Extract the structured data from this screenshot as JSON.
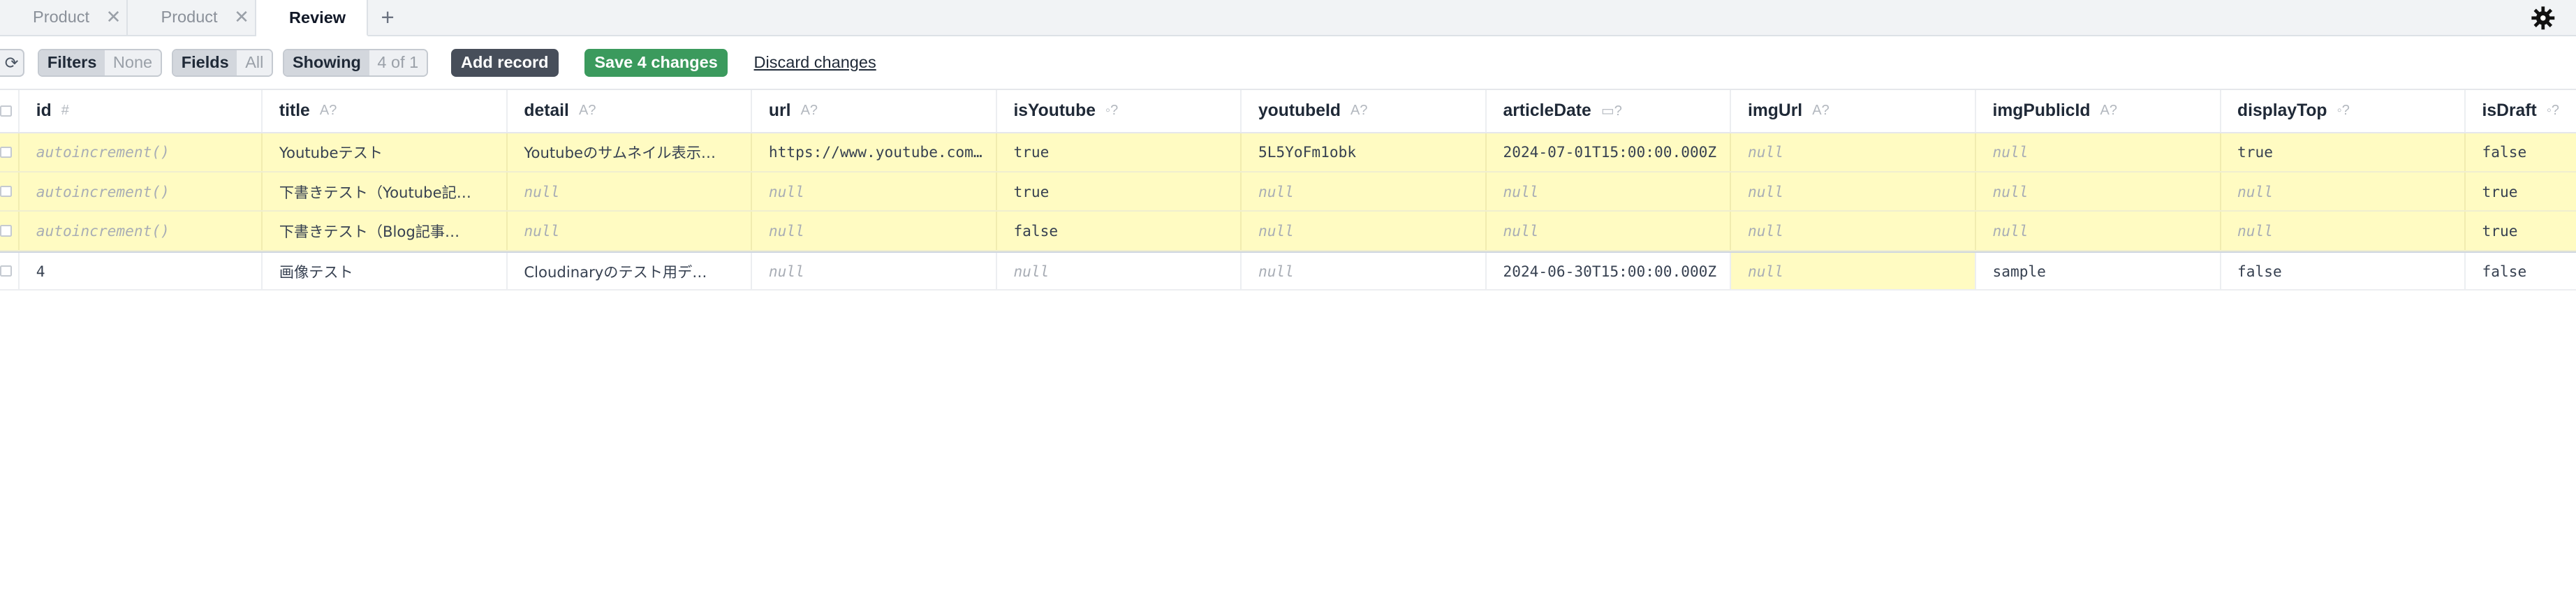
{
  "tabs": [
    {
      "label": "Product",
      "active": false,
      "closable": true
    },
    {
      "label": "Product",
      "active": false,
      "closable": true
    },
    {
      "label": "Review",
      "active": true,
      "modified": true
    }
  ],
  "tab_add_label": "+",
  "toolbar": {
    "refresh_label": "⟳",
    "filters": {
      "label": "Filters",
      "value": "None"
    },
    "fields": {
      "label": "Fields",
      "value": "All"
    },
    "showing": {
      "label": "Showing",
      "value": "4 of 1"
    },
    "add_record": "Add record",
    "save_changes": "Save 4 changes",
    "discard_changes": "Discard changes"
  },
  "columns": [
    {
      "name": "id",
      "type": "#"
    },
    {
      "name": "title",
      "type": "A?"
    },
    {
      "name": "detail",
      "type": "A?"
    },
    {
      "name": "url",
      "type": "A?"
    },
    {
      "name": "isYoutube",
      "type": "◦?"
    },
    {
      "name": "youtubeId",
      "type": "A?"
    },
    {
      "name": "articleDate",
      "type": "▭?"
    },
    {
      "name": "imgUrl",
      "type": "A?"
    },
    {
      "name": "imgPublicId",
      "type": "A?"
    },
    {
      "name": "displayTop",
      "type": "◦?"
    },
    {
      "name": "isDraft",
      "type": "◦?"
    }
  ],
  "rows": [
    {
      "new": true,
      "cells": [
        "autoincrement()",
        "Youtubeテスト",
        "Youtubeのサムネイル表示…",
        "https://www.youtube.com…",
        "true",
        "5L5YoFm1obk",
        "2024-07-01T15:00:00.000Z",
        "null",
        "null",
        "true",
        "false"
      ]
    },
    {
      "new": true,
      "cells": [
        "autoincrement()",
        "下書きテスト（Youtube記…",
        "null",
        "null",
        "true",
        "null",
        "null",
        "null",
        "null",
        "null",
        "true"
      ]
    },
    {
      "new": true,
      "cells": [
        "autoincrement()",
        "下書きテスト（Blog記事…",
        "null",
        "null",
        "false",
        "null",
        "null",
        "null",
        "null",
        "null",
        "true"
      ]
    },
    {
      "new": false,
      "cells": [
        "4",
        "画像テスト",
        "Cloudinaryのテスト用デ…",
        "null",
        "null",
        "null",
        "2024-06-30T15:00:00.000Z",
        "null",
        "sample",
        "false",
        "false"
      ]
    }
  ],
  "colors": {
    "new_row": "#fffbc2",
    "save_button": "#3b9a5d",
    "add_button": "#474e5a"
  }
}
